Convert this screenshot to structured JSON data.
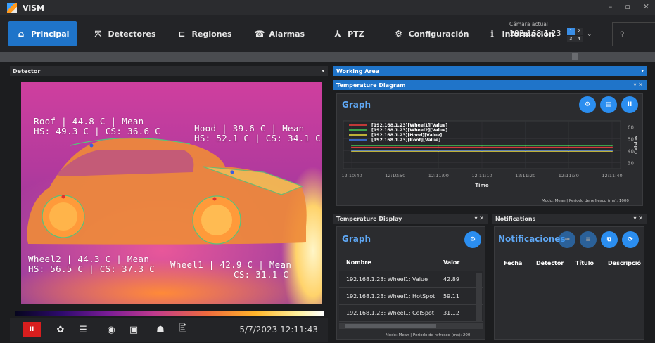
{
  "window": {
    "title": "ViSM",
    "controls": [
      "–",
      "▫",
      "✕"
    ]
  },
  "nav": {
    "items": [
      {
        "label": "Principal",
        "icon": "home-icon",
        "glyph": "⌂"
      },
      {
        "label": "Detectores",
        "icon": "detector-icon",
        "glyph": "⤧"
      },
      {
        "label": "Regiones",
        "icon": "regions-icon",
        "glyph": "⊏"
      },
      {
        "label": "Alarmas",
        "icon": "alarm-icon",
        "glyph": "☎"
      },
      {
        "label": "PTZ",
        "icon": "ptz-icon",
        "glyph": "⅄"
      },
      {
        "label": "Configuración",
        "icon": "gear-icon",
        "glyph": "⚙"
      },
      {
        "label": "Información",
        "icon": "info-icon",
        "glyph": "ℹ"
      }
    ],
    "camera": {
      "label": "Cámara actual",
      "ip": "192.168.1.23",
      "selector": [
        "1",
        "2",
        "3",
        "4"
      ],
      "dropdown": "⌄"
    },
    "user_glyph": "⚲"
  },
  "detector_panel": {
    "title": "Detector",
    "arrow": "▾"
  },
  "working_area": {
    "title": "Working Area",
    "arrow": "▾"
  },
  "overlays": {
    "roof": {
      "line1": "Roof | 44.8 C | Mean",
      "line2": "HS: 49.3 C | CS: 36.6 C"
    },
    "hood": {
      "line1": "Hood | 39.6 C | Mean",
      "line2": "HS: 52.1 C | CS: 34.1 C"
    },
    "wheel2": {
      "line1": "Wheel2 | 44.3 C | Mean",
      "line2": "HS: 56.5 C | CS: 37.3 C"
    },
    "wheel1": {
      "line1": "Wheel1 | 42.9 C | Mean",
      "line2": "CS: 31.1 C"
    }
  },
  "bottom": {
    "pause_label": "II",
    "datetime": "5/7/2023 12:11:43",
    "tools": [
      "✿",
      "☰",
      "◉",
      "▣",
      "☗",
      "🖹"
    ]
  },
  "temp_diagram": {
    "title": "Temperature Diagram",
    "graph_title": "Graph",
    "buttons": [
      "⚙",
      "▤",
      "II"
    ],
    "footnote": "Modo: Mean | Periodo de refresco (ms): 1000",
    "close": "▾ ✕"
  },
  "chart_data": {
    "type": "line",
    "x": [
      "12:10:40",
      "12:10:50",
      "12:11:00",
      "12:11:10",
      "12:11:20",
      "12:11:30",
      "12:11:40"
    ],
    "xlabel": "Time",
    "ylabel": "Celsius",
    "ylim": [
      25,
      65
    ],
    "yticks": [
      30,
      40,
      50,
      60
    ],
    "series": [
      {
        "name": "[192.168.1.23][Wheel1][Value]",
        "color": "#d63b3b",
        "values": [
          42.9,
          42.9,
          42.9,
          42.9,
          42.9,
          42.9,
          42.9
        ]
      },
      {
        "name": "[192.168.1.23][Wheel2][Value]",
        "color": "#3fb34f",
        "values": [
          44.3,
          44.3,
          44.3,
          44.3,
          44.3,
          44.3,
          44.3
        ]
      },
      {
        "name": "[192.168.1.23][Hood][Value]",
        "color": "#d4c53a",
        "values": [
          39.6,
          39.6,
          39.6,
          39.6,
          39.6,
          39.6,
          39.6
        ]
      },
      {
        "name": "[192.168.1.23][Roof][Value]",
        "color": "#3b6fd6",
        "values": [
          40.2,
          40.2,
          40.2,
          40.2,
          40.2,
          40.2,
          40.2
        ]
      }
    ]
  },
  "temp_display": {
    "title": "Temperature Display",
    "graph_title": "Graph",
    "button": "⚙",
    "close": "▾ ✕",
    "columns": [
      "Nombre",
      "Valor"
    ],
    "rows": [
      {
        "name": "192.168.1.23: Wheel1: Value",
        "value": "42.89"
      },
      {
        "name": "192.168.1.23: Wheel1: HotSpot",
        "value": "59.11"
      },
      {
        "name": "192.168.1.23: Wheel1: ColSpot",
        "value": "31.12"
      }
    ],
    "footnote": "Modo: Mean | Periodo de refresco (ms): 200"
  },
  "notifications": {
    "title": "Notifications",
    "heading": "Notificaciones",
    "close": "▾ ✕",
    "buttons": [
      "⇥",
      "≡",
      "⧉",
      "⟳"
    ],
    "columns": [
      "Fecha",
      "Detector",
      "Título",
      "Descripció"
    ]
  }
}
